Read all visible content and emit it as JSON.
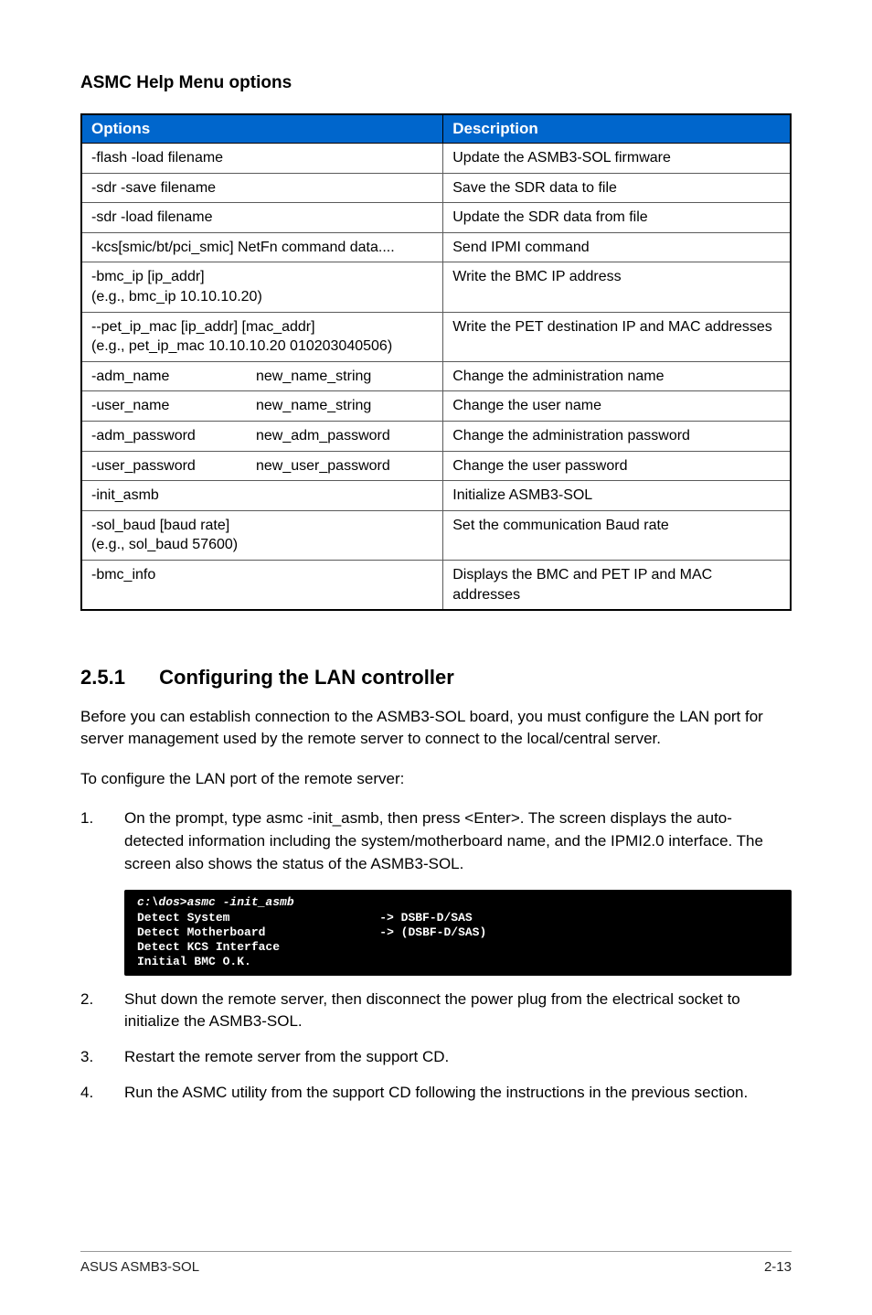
{
  "title": "ASMC Help Menu options",
  "table": {
    "headers": {
      "options": "Options",
      "description": "Description"
    },
    "rows": [
      {
        "opt": "-flash -load filename",
        "desc": "Update the ASMB3-SOL firmware"
      },
      {
        "opt": "-sdr -save filename",
        "desc": "Save the SDR data to file"
      },
      {
        "opt": "-sdr -load filename",
        "desc": "Update the SDR data from file"
      },
      {
        "opt": "-kcs[smic/bt/pci_smic] NetFn command data....",
        "desc": "Send IPMI command"
      },
      {
        "opt": "-bmc_ip [ip_addr]\n(e.g., bmc_ip 10.10.10.20)",
        "desc": "Write the BMC IP address"
      },
      {
        "opt": "--pet_ip_mac [ip_addr] [mac_addr]\n(e.g., pet_ip_mac 10.10.10.20 010203040506)",
        "desc": "Write the PET destination IP and MAC addresses"
      },
      {
        "opt_label": "-adm_name",
        "opt_arg": "new_name_string",
        "desc": "Change the administration name"
      },
      {
        "opt_label": "-user_name",
        "opt_arg": "new_name_string",
        "desc": "Change the user name"
      },
      {
        "opt_label": "-adm_password",
        "opt_arg": "new_adm_password",
        "desc": "Change the administration password"
      },
      {
        "opt_label": "-user_password",
        "opt_arg": "new_user_password",
        "desc": "Change the user password"
      },
      {
        "opt": "-init_asmb",
        "desc": "Initialize ASMB3-SOL"
      },
      {
        "opt": "-sol_baud [baud rate]\n(e.g., sol_baud 57600)",
        "desc": "Set the communication Baud rate"
      },
      {
        "opt": "-bmc_info",
        "desc": "Displays the BMC and PET IP and MAC  addresses"
      }
    ]
  },
  "section": {
    "num": "2.5.1",
    "title": "Configuring the LAN controller"
  },
  "intro": "Before you can establish connection to the ASMB3-SOL board, you must configure the LAN port for server management used by the remote server to connect to the local/central server.",
  "lead": "To configure the LAN port of the remote server:",
  "steps": [
    "On the prompt, type asmc -init_asmb, then press <Enter>. The screen displays the auto-detected information including the system/motherboard name, and the IPMI2.0 interface. The screen also shows the status of the ASMB3-SOL.",
    "Shut down the remote server, then disconnect the power plug from the electrical socket to initialize the ASMB3-SOL.",
    "Restart the remote server from the support CD.",
    "Run the ASMC utility from the support CD following the instructions in the previous section."
  ],
  "terminal": {
    "line1": "c:\\dos>asmc -init_asmb",
    "line2a": "Detect System",
    "line2b": "-> DSBF-D/SAS",
    "line3a": "Detect Motherboard",
    "line3b": "-> (DSBF-D/SAS)",
    "line4": "Detect KCS Interface",
    "line5": "Initial BMC O.K."
  },
  "footer": {
    "left": "ASUS ASMB3-SOL",
    "right": "2-13"
  }
}
